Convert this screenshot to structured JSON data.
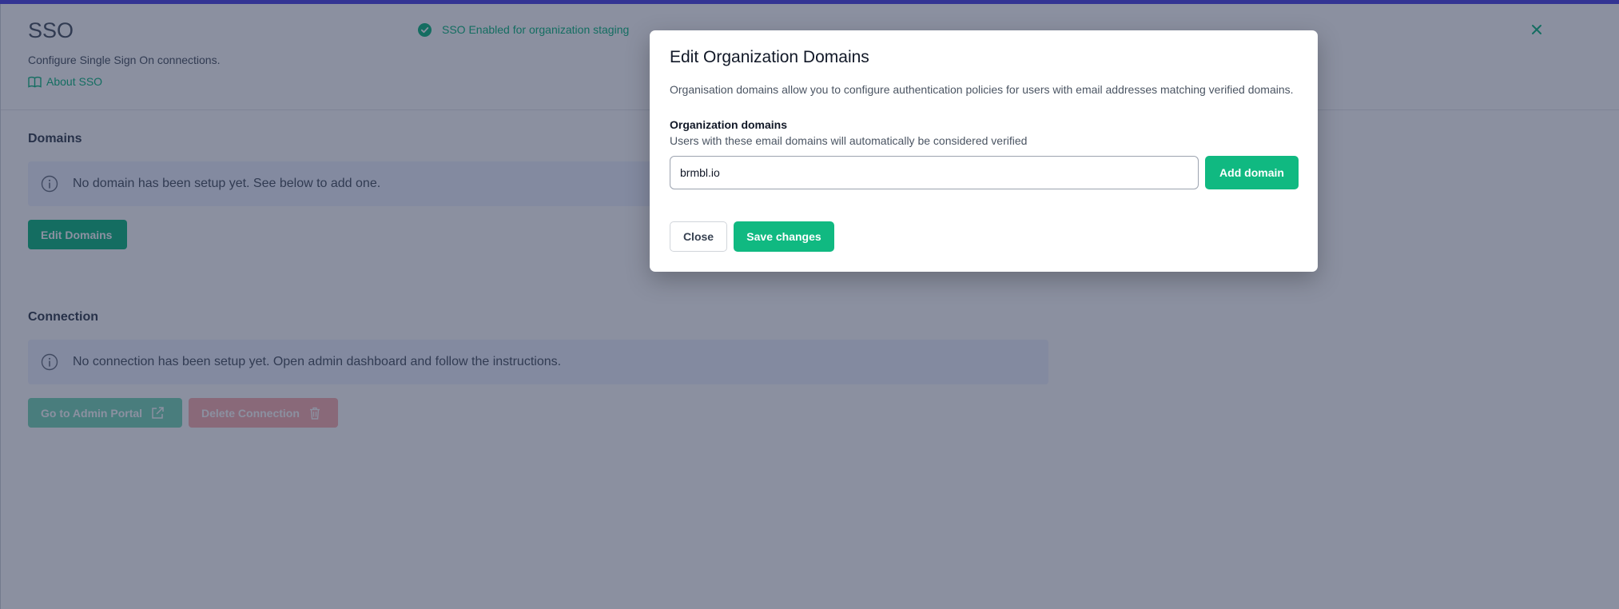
{
  "page": {
    "title": "SSO",
    "subtitle": "Configure Single Sign On connections.",
    "about_link": "About SSO",
    "about_icon": "book-icon"
  },
  "toast": {
    "message": "SSO Enabled for organization staging",
    "icon": "check-circle-icon",
    "close_icon": "close-icon",
    "color": "#10b981"
  },
  "domains": {
    "title": "Domains",
    "empty_message": "No domain has been setup yet. See below to add one.",
    "edit_button": "Edit Domains"
  },
  "connection": {
    "title": "Connection",
    "empty_message": "No connection has been setup yet. Open admin dashboard and follow the instructions.",
    "admin_portal_button": "Go to Admin Portal",
    "delete_button": "Delete Connection"
  },
  "modal": {
    "title": "Edit Organization Domains",
    "description": "Organisation domains allow you to configure authentication policies for users with email addresses matching verified domains.",
    "field_label": "Organization domains",
    "field_help": "Users with these email domains will automatically be considered verified",
    "input_value": "brmbl.io",
    "add_button": "Add domain",
    "close_button": "Close",
    "save_button": "Save changes"
  },
  "colors": {
    "accent": "#10b981",
    "danger": "#f87171",
    "brand": "#4f46e5",
    "info_bg": "#eef2ff"
  }
}
